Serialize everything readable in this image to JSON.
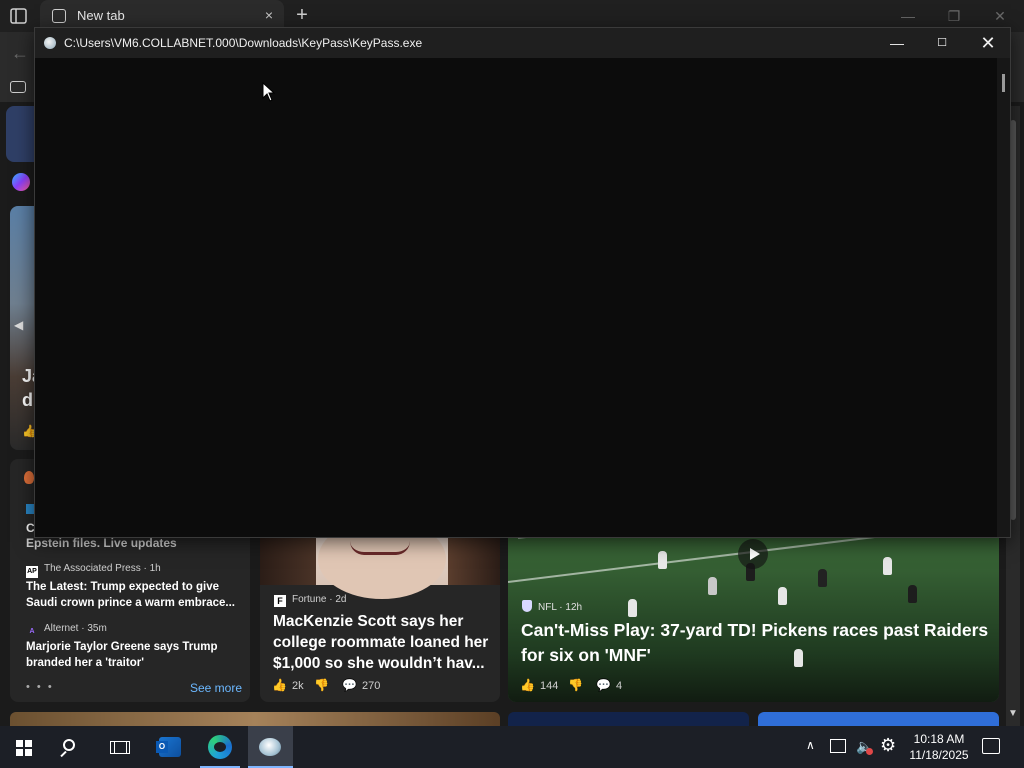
{
  "browser": {
    "tab_title": "New tab",
    "tab_close_icon": "×",
    "newtab_icon": "+",
    "back_icon": "←",
    "minimize_icon": "—",
    "restore_icon": "❐",
    "close_icon": "✕"
  },
  "feed": {
    "left_sliver": {
      "line1": "Ja",
      "line2": "d",
      "arrow": "◀",
      "like": "👍"
    },
    "list_card": {
      "partial_text_1": "C",
      "partial_text_2": "Epstein files. Live updates",
      "items": [
        {
          "source": "The Associated Press · 1h",
          "source_icon": "AP",
          "headline": "The Latest: Trump expected to give Saudi crown prince a warm embrace..."
        },
        {
          "source": "Alternet · 35m",
          "source_icon": "A",
          "headline": "Marjorie Taylor Greene says Trump branded her a 'traitor'"
        }
      ],
      "dots": "• • •",
      "see_more": "See more"
    },
    "fortune_card": {
      "source": "Fortune · 2d",
      "logo": "F",
      "headline": "MacKenzie Scott says her college roommate loaned her $1,000 so she wouldn’t hav...",
      "likes": "2k",
      "comments": "270",
      "like_icon": "👍",
      "dislike_icon": "👎",
      "comment_icon": "💬"
    },
    "nfl_card": {
      "source": "NFL · 12h",
      "headline": "Can't-Miss Play: 37-yard TD! Pickens races past Raiders for six on 'MNF'",
      "likes": "144",
      "comments": "4",
      "like_icon": "👍",
      "dislike_icon": "👎",
      "comment_icon": "💬"
    }
  },
  "console": {
    "title": "C:\\Users\\VM6.COLLABNET.000\\Downloads\\KeyPass\\KeyPass.exe",
    "minimize_icon": "—",
    "maximize_icon": "☐",
    "close_icon": "✕",
    "colors": {
      "background": "#0c0c0c",
      "titlebar": "#1f1f1f"
    }
  },
  "taskbar": {
    "time": "10:18 AM",
    "date": "11/18/2025",
    "tray_chevron": "∧",
    "volume_icon": "🔈",
    "settings_icon": "⚙"
  }
}
